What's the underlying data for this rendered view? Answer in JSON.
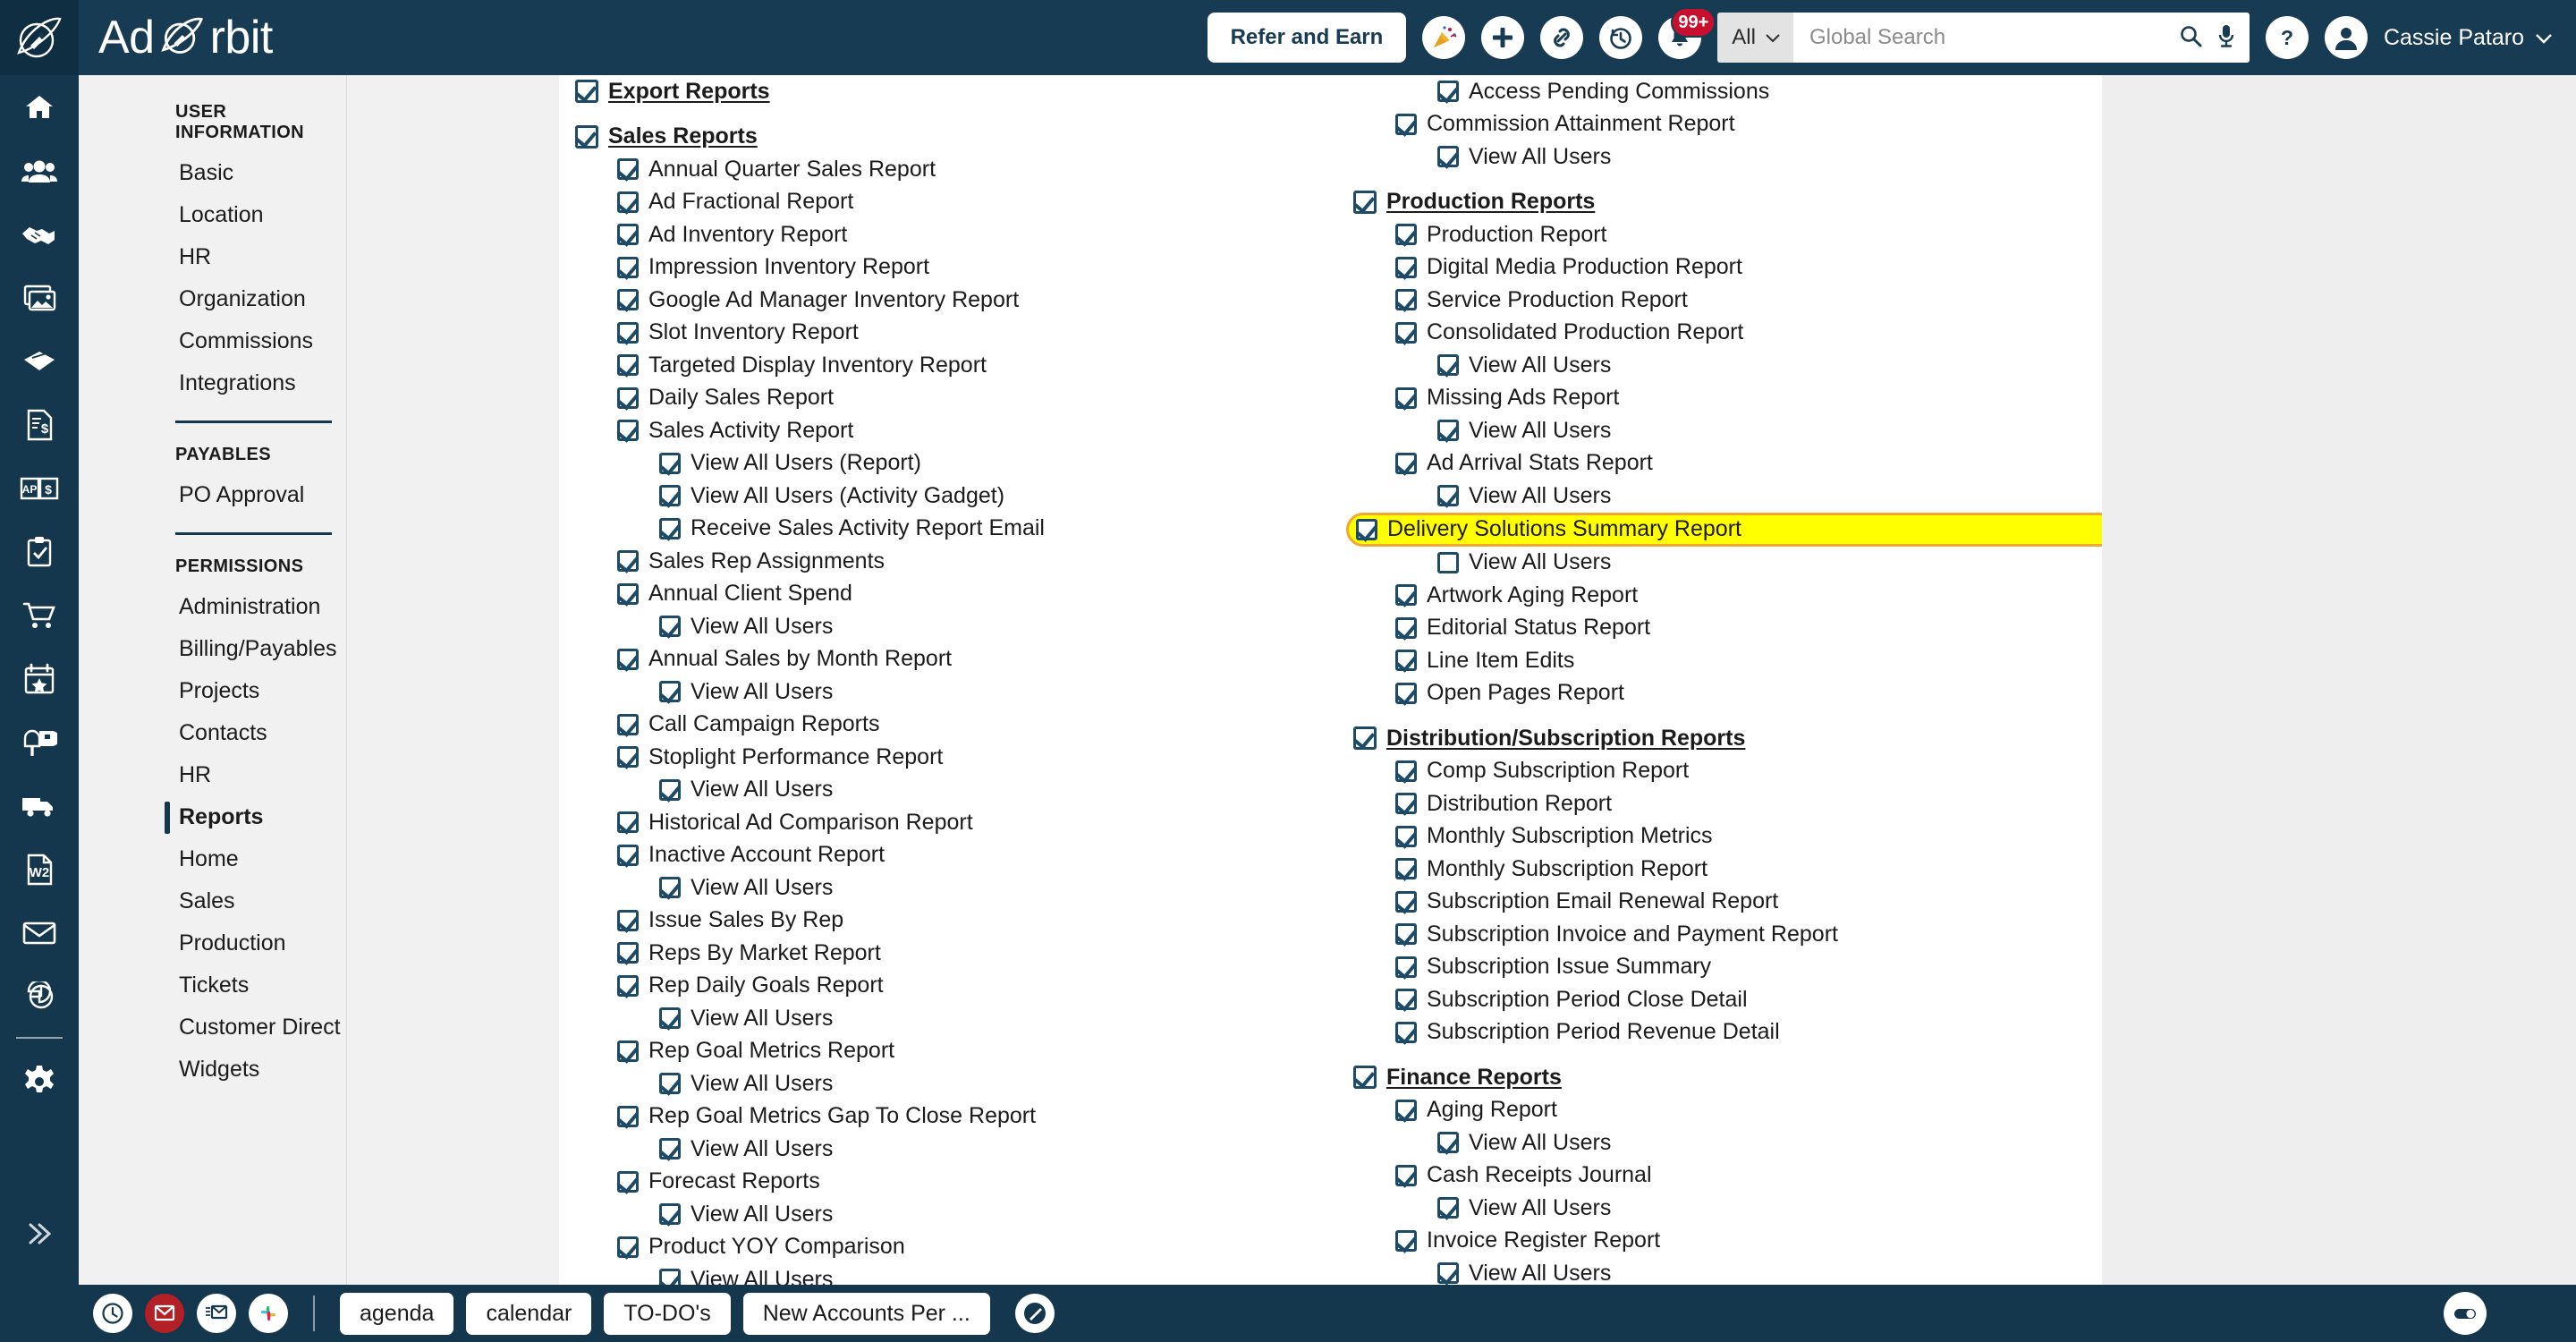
{
  "brand": {
    "name": "Ad Orbit",
    "logo_icon": "orbit-rocket-icon"
  },
  "header": {
    "refer_label": "Refer and Earn",
    "icons": [
      {
        "name": "party-popper-icon"
      },
      {
        "name": "plus-icon"
      },
      {
        "name": "link-icon"
      },
      {
        "name": "history-clock-icon"
      },
      {
        "name": "bell-icon",
        "badge": "99+"
      }
    ],
    "search": {
      "scope": "All",
      "placeholder": "Global Search",
      "value": ""
    },
    "help_icon": "question-mark-icon",
    "user": {
      "name": "Cassie Pataro",
      "avatar_icon": "user-avatar-icon"
    }
  },
  "rail": {
    "items": [
      {
        "name": "home-icon"
      },
      {
        "name": "people-icon"
      },
      {
        "name": "handshake-icon"
      },
      {
        "name": "images-icon"
      },
      {
        "name": "ticket-icon"
      },
      {
        "name": "invoice-dollar-icon"
      },
      {
        "name": "ap-dollar-book-icon"
      },
      {
        "name": "clipboard-check-icon"
      },
      {
        "name": "shopping-cart-icon"
      },
      {
        "name": "calendar-star-icon"
      },
      {
        "name": "mailbox-icon"
      },
      {
        "name": "truck-icon"
      },
      {
        "name": "w2-document-icon"
      },
      {
        "name": "envelope-icon"
      },
      {
        "name": "pie-chart-icon"
      }
    ],
    "settings_icon": "gear-icon",
    "expand_icon": "chevron-double-right-icon"
  },
  "nav": {
    "groups": [
      {
        "header": "User Information",
        "items": [
          {
            "label": "Basic",
            "active": false
          },
          {
            "label": "Location",
            "active": false
          },
          {
            "label": "HR",
            "active": false
          },
          {
            "label": "Organization",
            "active": false
          },
          {
            "label": "Commissions",
            "active": false
          },
          {
            "label": "Integrations",
            "active": false
          }
        ]
      },
      {
        "header": "Payables",
        "items": [
          {
            "label": "PO Approval",
            "active": false
          }
        ]
      },
      {
        "header": "Permissions",
        "items": [
          {
            "label": "Administration",
            "active": false
          },
          {
            "label": "Billing/Payables",
            "active": false
          },
          {
            "label": "Projects",
            "active": false
          },
          {
            "label": "Contacts",
            "active": false
          },
          {
            "label": "HR",
            "active": false
          },
          {
            "label": "Reports",
            "active": true
          },
          {
            "label": "Home",
            "active": false
          },
          {
            "label": "Sales",
            "active": false
          },
          {
            "label": "Production",
            "active": false
          },
          {
            "label": "Tickets",
            "active": false
          },
          {
            "label": "Customer Direct",
            "active": false
          },
          {
            "label": "Widgets",
            "active": false
          }
        ]
      }
    ]
  },
  "colors": {
    "brand_navy": "#14374d",
    "checkbox": "#1d4a66",
    "highlight_fill": "#ffff00",
    "highlight_border": "#f0a830",
    "badge_red": "#c8102e"
  },
  "permissions": {
    "left_column": [
      {
        "label": "Export Reports",
        "level": 0,
        "checked": true,
        "group": true
      },
      {
        "label": "Sales Reports",
        "level": 0,
        "checked": true,
        "group": true,
        "spacer": true
      },
      {
        "label": "Annual Quarter Sales Report",
        "level": 1,
        "checked": true
      },
      {
        "label": "Ad Fractional Report",
        "level": 1,
        "checked": true
      },
      {
        "label": "Ad Inventory Report",
        "level": 1,
        "checked": true
      },
      {
        "label": "Impression Inventory Report",
        "level": 1,
        "checked": true
      },
      {
        "label": "Google Ad Manager Inventory Report",
        "level": 1,
        "checked": true
      },
      {
        "label": "Slot Inventory Report",
        "level": 1,
        "checked": true
      },
      {
        "label": "Targeted Display Inventory Report",
        "level": 1,
        "checked": true
      },
      {
        "label": "Daily Sales Report",
        "level": 1,
        "checked": true
      },
      {
        "label": "Sales Activity Report",
        "level": 1,
        "checked": true
      },
      {
        "label": "View All Users (Report)",
        "level": 2,
        "checked": true
      },
      {
        "label": "View All Users (Activity Gadget)",
        "level": 2,
        "checked": true
      },
      {
        "label": "Receive Sales Activity Report Email",
        "level": 2,
        "checked": true
      },
      {
        "label": "Sales Rep Assignments",
        "level": 1,
        "checked": true
      },
      {
        "label": "Annual Client Spend",
        "level": 1,
        "checked": true
      },
      {
        "label": "View All Users",
        "level": 2,
        "checked": true
      },
      {
        "label": "Annual Sales by Month Report",
        "level": 1,
        "checked": true
      },
      {
        "label": "View All Users",
        "level": 2,
        "checked": true
      },
      {
        "label": "Call Campaign Reports",
        "level": 1,
        "checked": true
      },
      {
        "label": "Stoplight Performance Report",
        "level": 1,
        "checked": true
      },
      {
        "label": "View All Users",
        "level": 2,
        "checked": true
      },
      {
        "label": "Historical Ad Comparison Report",
        "level": 1,
        "checked": true
      },
      {
        "label": "Inactive Account Report",
        "level": 1,
        "checked": true
      },
      {
        "label": "View All Users",
        "level": 2,
        "checked": true
      },
      {
        "label": "Issue Sales By Rep",
        "level": 1,
        "checked": true
      },
      {
        "label": "Reps By Market Report",
        "level": 1,
        "checked": true
      },
      {
        "label": "Rep Daily Goals Report",
        "level": 1,
        "checked": true
      },
      {
        "label": "View All Users",
        "level": 2,
        "checked": true
      },
      {
        "label": "Rep Goal Metrics Report",
        "level": 1,
        "checked": true
      },
      {
        "label": "View All Users",
        "level": 2,
        "checked": true
      },
      {
        "label": "Rep Goal Metrics Gap To Close Report",
        "level": 1,
        "checked": true
      },
      {
        "label": "View All Users",
        "level": 2,
        "checked": true
      },
      {
        "label": "Forecast Reports",
        "level": 1,
        "checked": true
      },
      {
        "label": "View All Users",
        "level": 2,
        "checked": true
      },
      {
        "label": "Product YOY Comparison",
        "level": 1,
        "checked": true
      },
      {
        "label": "View All Users",
        "level": 2,
        "checked": true
      }
    ],
    "right_column": [
      {
        "label": "Access Pending Commissions",
        "level": 2,
        "checked": true
      },
      {
        "label": "Commission Attainment Report",
        "level": 1,
        "checked": true
      },
      {
        "label": "View All Users",
        "level": 2,
        "checked": true
      },
      {
        "label": "Production Reports",
        "level": 0,
        "checked": true,
        "group": true,
        "spacer": true
      },
      {
        "label": "Production Report",
        "level": 1,
        "checked": true
      },
      {
        "label": "Digital Media Production Report",
        "level": 1,
        "checked": true
      },
      {
        "label": "Service Production Report",
        "level": 1,
        "checked": true
      },
      {
        "label": "Consolidated Production Report",
        "level": 1,
        "checked": true
      },
      {
        "label": "View All Users",
        "level": 2,
        "checked": true
      },
      {
        "label": "Missing Ads Report",
        "level": 1,
        "checked": true
      },
      {
        "label": "View All Users",
        "level": 2,
        "checked": true
      },
      {
        "label": "Ad Arrival Stats Report",
        "level": 1,
        "checked": true
      },
      {
        "label": "View All Users",
        "level": 2,
        "checked": true
      },
      {
        "label": "Delivery Solutions Summary Report",
        "level": 1,
        "checked": true,
        "highlight": true
      },
      {
        "label": "View All Users",
        "level": 2,
        "checked": false
      },
      {
        "label": "Artwork Aging Report",
        "level": 1,
        "checked": true
      },
      {
        "label": "Editorial Status Report",
        "level": 1,
        "checked": true
      },
      {
        "label": "Line Item Edits",
        "level": 1,
        "checked": true
      },
      {
        "label": "Open Pages Report",
        "level": 1,
        "checked": true
      },
      {
        "label": "Distribution/Subscription Reports",
        "level": 0,
        "checked": true,
        "group": true,
        "spacer": true
      },
      {
        "label": "Comp Subscription Report",
        "level": 1,
        "checked": true
      },
      {
        "label": "Distribution Report",
        "level": 1,
        "checked": true
      },
      {
        "label": "Monthly Subscription Metrics",
        "level": 1,
        "checked": true
      },
      {
        "label": "Monthly Subscription Report",
        "level": 1,
        "checked": true
      },
      {
        "label": "Subscription Email Renewal Report",
        "level": 1,
        "checked": true
      },
      {
        "label": "Subscription Invoice and Payment Report",
        "level": 1,
        "checked": true
      },
      {
        "label": "Subscription Issue Summary",
        "level": 1,
        "checked": true
      },
      {
        "label": "Subscription Period Close Detail",
        "level": 1,
        "checked": true
      },
      {
        "label": "Subscription Period Revenue Detail",
        "level": 1,
        "checked": true
      },
      {
        "label": "Finance Reports",
        "level": 0,
        "checked": true,
        "group": true,
        "spacer": true
      },
      {
        "label": "Aging Report",
        "level": 1,
        "checked": true
      },
      {
        "label": "View All Users",
        "level": 2,
        "checked": true
      },
      {
        "label": "Cash Receipts Journal",
        "level": 1,
        "checked": true
      },
      {
        "label": "View All Users",
        "level": 2,
        "checked": true
      },
      {
        "label": "Invoice Register Report",
        "level": 1,
        "checked": true
      },
      {
        "label": "View All Users",
        "level": 2,
        "checked": true
      }
    ]
  },
  "taskbar": {
    "icons": [
      {
        "name": "clock-icon",
        "style": "white"
      },
      {
        "name": "unread-mail-icon",
        "style": "red"
      },
      {
        "name": "mail-list-icon",
        "style": "white"
      },
      {
        "name": "slack-icon",
        "style": "white"
      }
    ],
    "buttons": [
      "agenda",
      "calendar",
      "TO-DO's",
      "New Accounts Per ..."
    ],
    "edit_icon": "pencil-circle-icon",
    "toggle_icon": "toggle-switch-icon"
  }
}
